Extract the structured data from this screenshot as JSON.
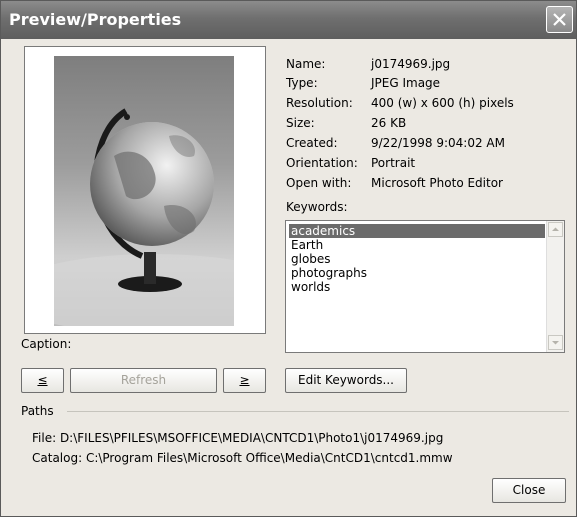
{
  "window": {
    "title": "Preview/Properties"
  },
  "properties": [
    {
      "label": "Name:",
      "value": "j0174969.jpg"
    },
    {
      "label": "Type:",
      "value": "JPEG Image"
    },
    {
      "label": "Resolution:",
      "value": "400 (w) x 600 (h) pixels"
    },
    {
      "label": "Size:",
      "value": "26 KB"
    },
    {
      "label": "Created:",
      "value": "9/22/1998 9:04:02 AM"
    },
    {
      "label": "Orientation:",
      "value": "Portrait"
    },
    {
      "label": "Open with:",
      "value": "Microsoft Photo Editor"
    }
  ],
  "keywords": {
    "label": "Keywords:",
    "items": [
      "academics",
      "Earth",
      "globes",
      "photographs",
      "worlds"
    ],
    "selected_index": 0
  },
  "caption": {
    "label": "Caption:"
  },
  "buttons": {
    "prev": "≤",
    "refresh": "Refresh",
    "next": "≥",
    "edit_keywords": "Edit Keywords...",
    "close": "Close"
  },
  "paths": {
    "group_label": "Paths",
    "file": "File: D:\\FILES\\PFILES\\MSOFFICE\\MEDIA\\CNTCD1\\Photo1\\j0174969.jpg",
    "catalog": "Catalog: C:\\Program Files\\Microsoft Office\\Media\\CntCD1\\cntcd1.mmw"
  },
  "icons": {
    "close": "close-icon",
    "scroll_up": "scroll-up-arrow-icon",
    "scroll_down": "scroll-down-arrow-icon"
  }
}
